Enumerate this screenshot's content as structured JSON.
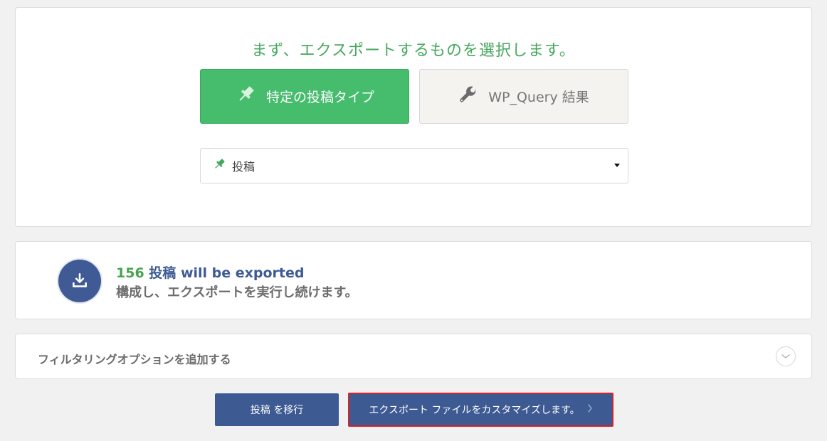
{
  "select_section": {
    "heading": "まず、エクスポートするものを選択します。",
    "post_type_button": {
      "label": "特定の投稿タイプ",
      "icon": "pushpin-icon"
    },
    "wp_query_button": {
      "label": "WP_Query 結果",
      "icon": "wrench-icon"
    },
    "post_select": {
      "selected": "投稿",
      "icon": "pushpin-icon"
    }
  },
  "summary": {
    "count": "156",
    "type_label": "投稿",
    "exported_text": "will be exported",
    "subtext": "構成し、エクスポートを実行し続けます。",
    "icon": "download-icon"
  },
  "filter": {
    "label": "フィルタリングオプションを追加する",
    "icon": "chevron-down-icon"
  },
  "actions": {
    "migrate_label": "投稿 を移行",
    "customize_label": "エクスポート ファイルをカスタマイズします。",
    "customize_icon": "chevron-right-icon"
  },
  "colors": {
    "accent_green": "#46bc6d",
    "primary_blue": "#3d5a93",
    "highlight_red": "#d3232e"
  }
}
